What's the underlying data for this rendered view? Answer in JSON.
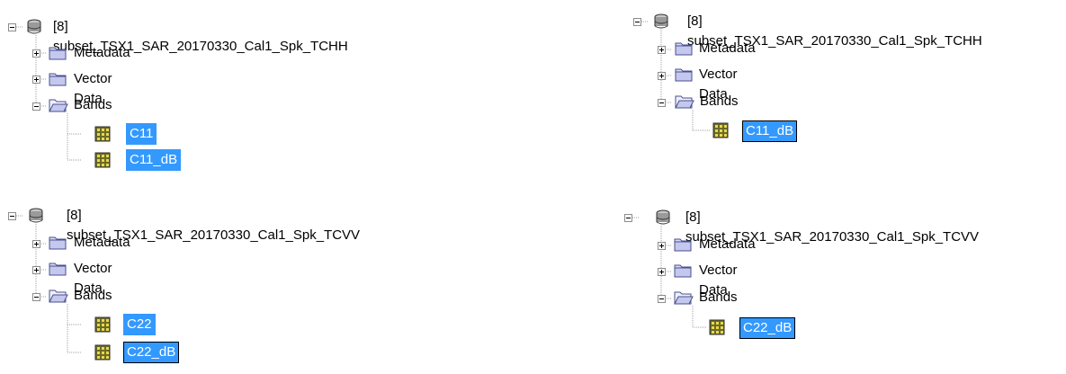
{
  "trees": [
    {
      "product": "[8] subset_TSX1_SAR_20170330_Cal1_Spk_TCHH",
      "children": [
        {
          "label": "Metadata",
          "icon": "folder-closed-icon"
        },
        {
          "label": "Vector Data",
          "icon": "folder-closed-icon"
        },
        {
          "label": "Bands",
          "icon": "folder-open-icon"
        }
      ],
      "bands": [
        "C11",
        "C11_dB"
      ]
    },
    {
      "product": "[8] subset_TSX1_SAR_20170330_Cal1_Spk_TCHH",
      "children": [
        {
          "label": "Metadata",
          "icon": "folder-closed-icon"
        },
        {
          "label": "Vector Data",
          "icon": "folder-closed-icon"
        },
        {
          "label": "Bands",
          "icon": "folder-open-icon"
        }
      ],
      "bands": [
        "C11_dB"
      ]
    },
    {
      "product": "[8] subset_TSX1_SAR_20170330_Cal1_Spk_TCVV",
      "children": [
        {
          "label": "Metadata",
          "icon": "folder-closed-icon"
        },
        {
          "label": "Vector Data",
          "icon": "folder-closed-icon"
        },
        {
          "label": "Bands",
          "icon": "folder-open-icon"
        }
      ],
      "bands": [
        "C22",
        "C22_dB"
      ]
    },
    {
      "product": "[8] subset_TSX1_SAR_20170330_Cal1_Spk_TCVV",
      "children": [
        {
          "label": "Metadata",
          "icon": "folder-closed-icon"
        },
        {
          "label": "Vector Data",
          "icon": "folder-closed-icon"
        },
        {
          "label": "Bands",
          "icon": "folder-open-icon"
        }
      ],
      "bands": [
        "C22_dB"
      ]
    }
  ],
  "colors": {
    "selection": "#3399ff",
    "folder_fill": "#d7daf5",
    "folder_stroke": "#4a4f8c"
  }
}
